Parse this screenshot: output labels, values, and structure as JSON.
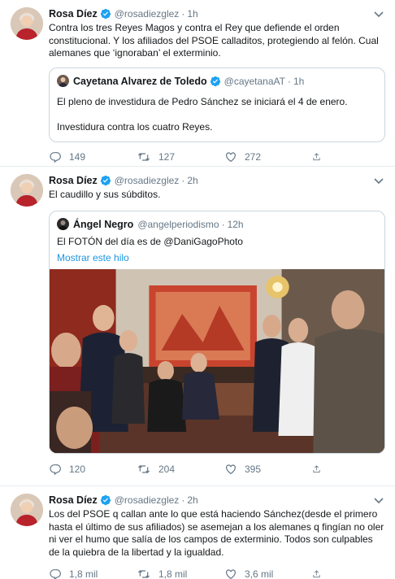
{
  "tweets": [
    {
      "author": "Rosa Díez",
      "handle": "@rosadiezglez",
      "time": "1h",
      "text": "Contra los tres Reyes Magos y contra el Rey que defiende el orden constitucional. Y los afiliados del PSOE calladitos, protegiendo al felón. Cual alemanes que ‘ignoraban’ el exterminio.",
      "quote": {
        "author": "Cayetana Alvarez de Toledo",
        "handle": "@cayetanaAT",
        "time": "1h",
        "line1": "El pleno de investidura de Pedro Sánchez se iniciará el 4 de enero.",
        "line2": "Investidura contra los cuatro Reyes."
      },
      "replies": "149",
      "retweets": "127",
      "likes": "272"
    },
    {
      "author": "Rosa Díez",
      "handle": "@rosadiezglez",
      "time": "2h",
      "text": "El caudillo y sus súbditos.",
      "quote": {
        "author": "Ángel Negro",
        "handle": "@angelperiodismo",
        "time": "12h",
        "text": "El FOTÓN del día es de @DaniGagoPhoto",
        "show_thread": "Mostrar este hilo"
      },
      "replies": "120",
      "retweets": "204",
      "likes": "395"
    },
    {
      "author": "Rosa Díez",
      "handle": "@rosadiezglez",
      "time": "2h",
      "text": "Los del PSOE q callan ante lo que está haciendo Sánchez(desde el primero hasta el último de sus afiliados) se asemejan a los alemanes q fingían no oler ni ver el humo que salía de los campos de exterminio. Todos son culpables de la quiebra de la libertad y la igualdad.",
      "replies": "1,8 mil",
      "retweets": "1,8 mil",
      "likes": "3,6 mil"
    }
  ],
  "colors": {
    "accent": "#1da1f2",
    "muted": "#657786",
    "border": "#e6ecf0",
    "link": "#1b95e0"
  },
  "icons": [
    "verified-icon",
    "chevron-down-icon",
    "reply-icon",
    "retweet-icon",
    "like-icon",
    "share-icon"
  ]
}
